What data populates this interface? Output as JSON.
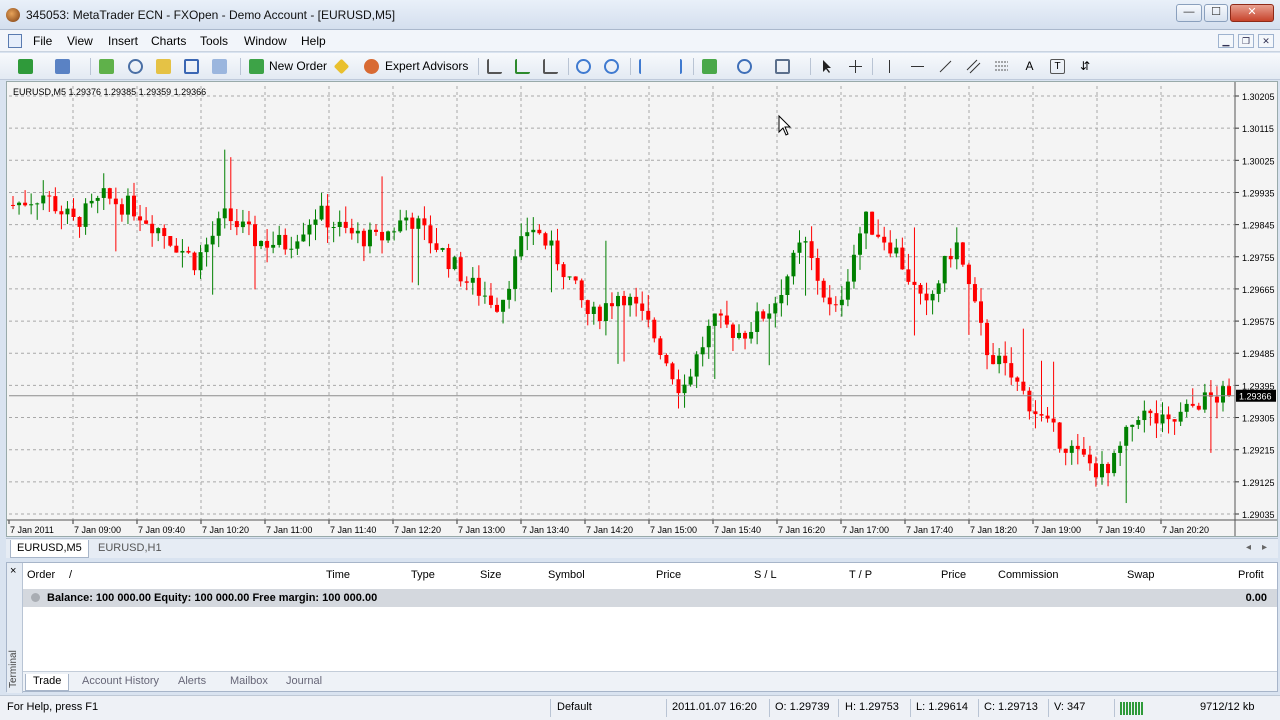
{
  "window": {
    "title": "345053: MetaTrader ECN - FXOpen - Demo Account - [EURUSD,M5]",
    "buttons": {
      "minimize": "—",
      "maximize": "☐",
      "close": "✕"
    }
  },
  "menu": {
    "items": [
      "File",
      "View",
      "Insert",
      "Charts",
      "Tools",
      "Window",
      "Help"
    ]
  },
  "toolbar": {
    "new_order": "New Order",
    "expert_advisors": "Expert Advisors"
  },
  "chart": {
    "symbol_info": "EURUSD,M5  1.29376 1.29385 1.29359 1.29366",
    "current_price_label": "1.29366",
    "colors": {
      "bull": "#008000",
      "bear": "#ff0000",
      "grid": "#a8a8a8",
      "background": "#f4f4f4"
    }
  },
  "chart_data": {
    "type": "candlestick",
    "title": "EURUSD,M5",
    "price_ticks": [
      "1.30205",
      "1.30115",
      "1.30025",
      "1.29935",
      "1.29845",
      "1.29755",
      "1.29665",
      "1.29575",
      "1.29485",
      "1.29395",
      "1.29305",
      "1.29215",
      "1.29125",
      "1.29035"
    ],
    "price_tick_values": [
      1.30205,
      1.30115,
      1.30025,
      1.29935,
      1.29845,
      1.29755,
      1.29665,
      1.29575,
      1.29485,
      1.29395,
      1.29305,
      1.29215,
      1.29125,
      1.29035
    ],
    "ylim": [
      1.29035,
      1.30205
    ],
    "time_ticks": [
      "7 Jan 2011",
      "7 Jan 09:00",
      "7 Jan 09:40",
      "7 Jan 10:20",
      "7 Jan 11:00",
      "7 Jan 11:40",
      "7 Jan 12:20",
      "7 Jan 13:00",
      "7 Jan 13:40",
      "7 Jan 14:20",
      "7 Jan 15:00",
      "7 Jan 15:40",
      "7 Jan 16:20",
      "7 Jan 17:00",
      "7 Jan 17:40",
      "7 Jan 18:20",
      "7 Jan 19:00",
      "7 Jan 19:40",
      "7 Jan 20:20"
    ],
    "current_price": 1.29366,
    "anchors": [
      [
        0,
        1.299
      ],
      [
        10,
        1.2993
      ],
      [
        20,
        1.2985
      ],
      [
        30,
        1.2992
      ],
      [
        40,
        1.2989
      ],
      [
        50,
        1.2982
      ],
      [
        60,
        1.2974
      ],
      [
        70,
        1.2987
      ],
      [
        80,
        1.298
      ],
      [
        90,
        1.2979
      ],
      [
        100,
        1.2988
      ],
      [
        110,
        1.2982
      ],
      [
        120,
        1.298
      ],
      [
        130,
        1.2987
      ],
      [
        140,
        1.2978
      ],
      [
        150,
        1.2968
      ],
      [
        160,
        1.2962
      ],
      [
        170,
        1.2985
      ],
      [
        180,
        1.2974
      ],
      [
        190,
        1.2958
      ],
      [
        200,
        1.2966
      ],
      [
        210,
        1.2955
      ],
      [
        220,
        1.2938
      ],
      [
        230,
        1.2957
      ],
      [
        240,
        1.2954
      ],
      [
        250,
        1.2962
      ],
      [
        260,
        1.298
      ],
      [
        270,
        1.2958
      ],
      [
        280,
        1.2986
      ],
      [
        290,
        1.2978
      ],
      [
        300,
        1.296
      ],
      [
        310,
        1.298
      ],
      [
        320,
        1.295
      ],
      [
        330,
        1.294
      ],
      [
        340,
        1.2928
      ],
      [
        350,
        1.292
      ],
      [
        360,
        1.2914
      ],
      [
        370,
        1.2932
      ],
      [
        380,
        1.2928
      ],
      [
        390,
        1.2935
      ],
      [
        400,
        1.2937
      ]
    ]
  },
  "chart_tabs": [
    "EURUSD,M5",
    "EURUSD,H1"
  ],
  "terminal": {
    "side_label": "Terminal",
    "close": "×",
    "columns": [
      "Order",
      "/",
      "Time",
      "Type",
      "Size",
      "Symbol",
      "Price",
      "S / L",
      "T / P",
      "Price",
      "Commission",
      "Swap",
      "Profit"
    ],
    "balance_text": "Balance: 100 000.00  Equity: 100 000.00  Free margin: 100 000.00",
    "profit": "0.00",
    "tabs": [
      "Trade",
      "Account History",
      "Alerts",
      "Mailbox",
      "Journal"
    ]
  },
  "status": {
    "help": "For Help, press F1",
    "profile": "Default",
    "datetime": "2011.01.07 16:20",
    "open": "O: 1.29739",
    "high": "H: 1.29753",
    "low": "L: 1.29614",
    "close": "C: 1.29713",
    "volume": "V: 347",
    "traffic": "9712/12 kb"
  }
}
